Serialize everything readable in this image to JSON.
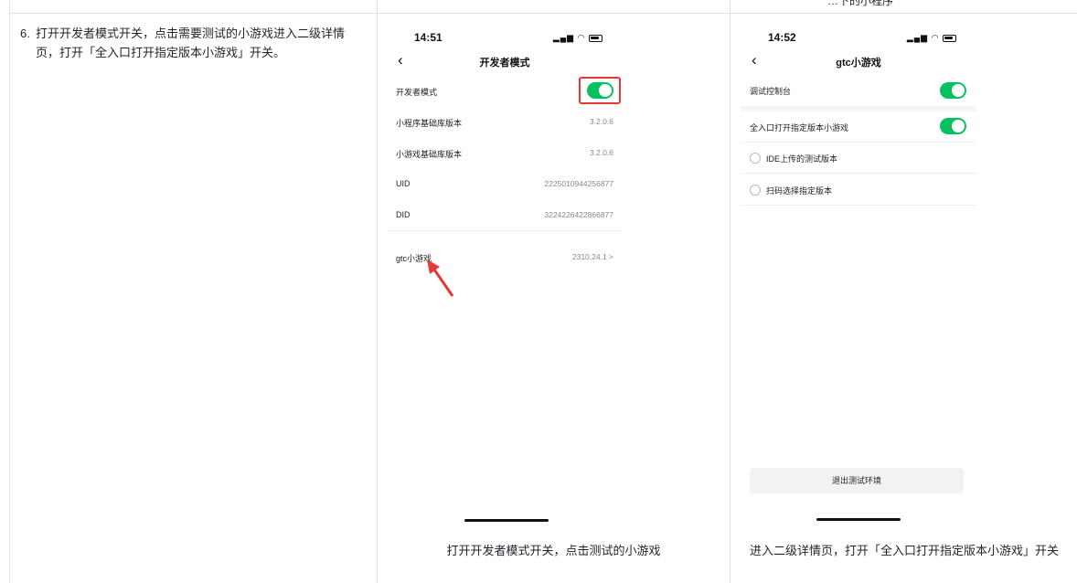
{
  "doc": {
    "cut_header_text": "…下的小程序",
    "step_number": "6.",
    "step_text": "打开开发者模式开关，点击需要测试的小游戏进入二级详情页，打开「全入口打开指定版本小游戏」开关。"
  },
  "phone1": {
    "time": "14:51",
    "nav_title": "开发者模式",
    "rows": [
      {
        "label": "开发者模式",
        "value": ""
      },
      {
        "label": "小程序基础库版本",
        "value": "3.2.0.6"
      },
      {
        "label": "小游戏基础库版本",
        "value": "3.2.0.6"
      },
      {
        "label": "UID",
        "value": "2225010944256877"
      },
      {
        "label": "DID",
        "value": "3224226422866877"
      }
    ],
    "game_row": {
      "label": "gtc小游戏",
      "value": "2310.24.1 >"
    },
    "caption": "打开开发者模式开关，点击测试的小游戏"
  },
  "phone2": {
    "time": "14:52",
    "nav_title": "gtc小游戏",
    "debug_label": "调试控制台",
    "open_all_label": "全入口打开指定版本小游戏",
    "option_ide": "IDE上传的测试版本",
    "option_scan": "扫码选择指定版本",
    "exit_button": "退出测试环境",
    "caption": "进入二级详情页，打开「全入口打开指定版本小游戏」开关"
  },
  "colors": {
    "toggle_on": "#07c160",
    "highlight": "#e53935",
    "grid": "#dee0e3"
  }
}
